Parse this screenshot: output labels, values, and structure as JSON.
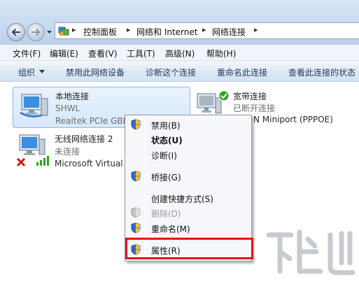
{
  "address": {
    "crumbs": [
      "控制面板",
      "网络和 Internet",
      "网络连接"
    ]
  },
  "menu": [
    "文件(F)",
    "编辑(E)",
    "查看(V)",
    "工具(T)",
    "高级(N)",
    "帮助(H)"
  ],
  "commands": [
    "组织",
    "禁用此网络设备",
    "诊断这个连接",
    "重命名此连接",
    "查看此连接的状态"
  ],
  "connections": [
    {
      "name": "本地连接",
      "status": "SHWL",
      "device": "Realtek PCIe GBE"
    },
    {
      "name": "宽带连接",
      "status": "已断开连接",
      "device": "N Miniport (PPPOE)"
    },
    {
      "name": "无线网络连接 2",
      "status": "未连接",
      "device": "Microsoft Virtual"
    }
  ],
  "context_menu": {
    "items": [
      {
        "label": "禁用(B)"
      },
      {
        "label": "状态(U)"
      },
      {
        "label": "诊断(I)"
      },
      {
        "label": "桥接(G)"
      },
      {
        "label": "创建快捷方式(S)"
      },
      {
        "label": "删除(D)"
      },
      {
        "label": "重命名(M)"
      },
      {
        "label": "属性(R)"
      }
    ]
  },
  "colors": {
    "highlight": "#e3121b",
    "selection": "#d5e8fb",
    "disconnected_x": "#d8141a",
    "connected_check": "#2fa51f"
  }
}
